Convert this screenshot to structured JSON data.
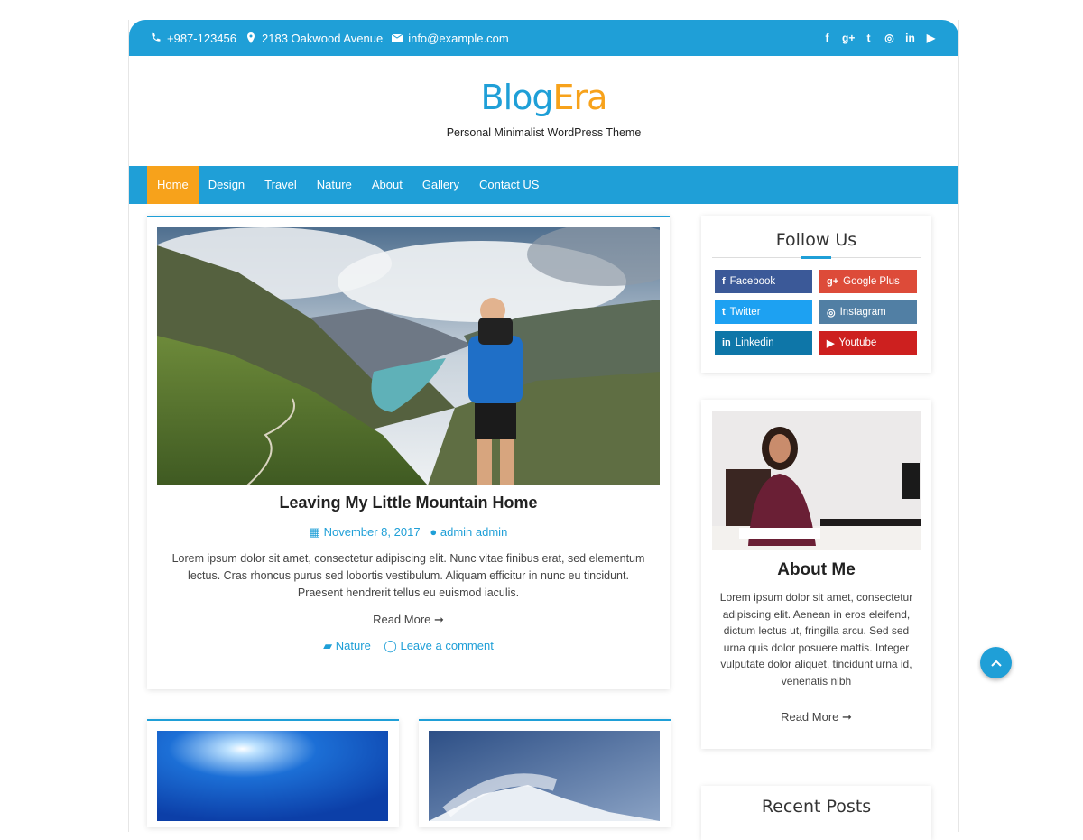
{
  "topbar": {
    "phone": "+987-123456",
    "address": "2183 Oakwood Avenue",
    "email": "info@example.com",
    "social_icons": [
      "facebook-icon",
      "google-plus-icon",
      "twitter-icon",
      "instagram-icon",
      "linkedin-icon",
      "youtube-icon"
    ]
  },
  "header": {
    "logo_part1": "Blog",
    "logo_part2": "Era",
    "tagline": "Personal Minimalist WordPress Theme"
  },
  "nav": {
    "items": [
      "Home",
      "Design",
      "Travel",
      "Nature",
      "About",
      "Gallery",
      "Contact US"
    ],
    "active": "Home"
  },
  "post": {
    "title": "Leaving My Little Mountain Home",
    "date": "November 8, 2017",
    "author": "admin admin",
    "excerpt": "Lorem ipsum dolor sit amet, consectetur adipiscing elit. Nunc vitae finibus erat, sed elementum lectus. Cras rhoncus purus sed lobortis vestibulum. Aliquam efficitur in nunc eu tincidunt. Praesent hendrerit tellus eu euismod iaculis.",
    "read_more": "Read More",
    "category": "Nature",
    "comment": "Leave a comment"
  },
  "follow": {
    "title": "Follow Us",
    "buttons": [
      {
        "label": "Facebook",
        "icon": "f",
        "color": "#3b5998"
      },
      {
        "label": "Google Plus",
        "icon": "g+",
        "color": "#dd4b39"
      },
      {
        "label": "Twitter",
        "icon": "t",
        "color": "#1da1f2"
      },
      {
        "label": "Instagram",
        "icon": "◎",
        "color": "#517fa4"
      },
      {
        "label": "Linkedin",
        "icon": "in",
        "color": "#0e76a8"
      },
      {
        "label": "Youtube",
        "icon": "▶",
        "color": "#cd201f"
      }
    ]
  },
  "about": {
    "title": "About Me",
    "text": "Lorem ipsum dolor sit amet, consectetur adipiscing elit. Aenean in eros eleifend, dictum lectus ut, fringilla arcu. Sed sed urna quis dolor posuere mattis. Integer vulputate dolor aliquet, tincidunt urna id, venenatis nibh",
    "read_more": "Read More"
  },
  "recent": {
    "title": "Recent Posts"
  },
  "colors": {
    "accent": "#1f9fd7",
    "active": "#f7a21b"
  }
}
